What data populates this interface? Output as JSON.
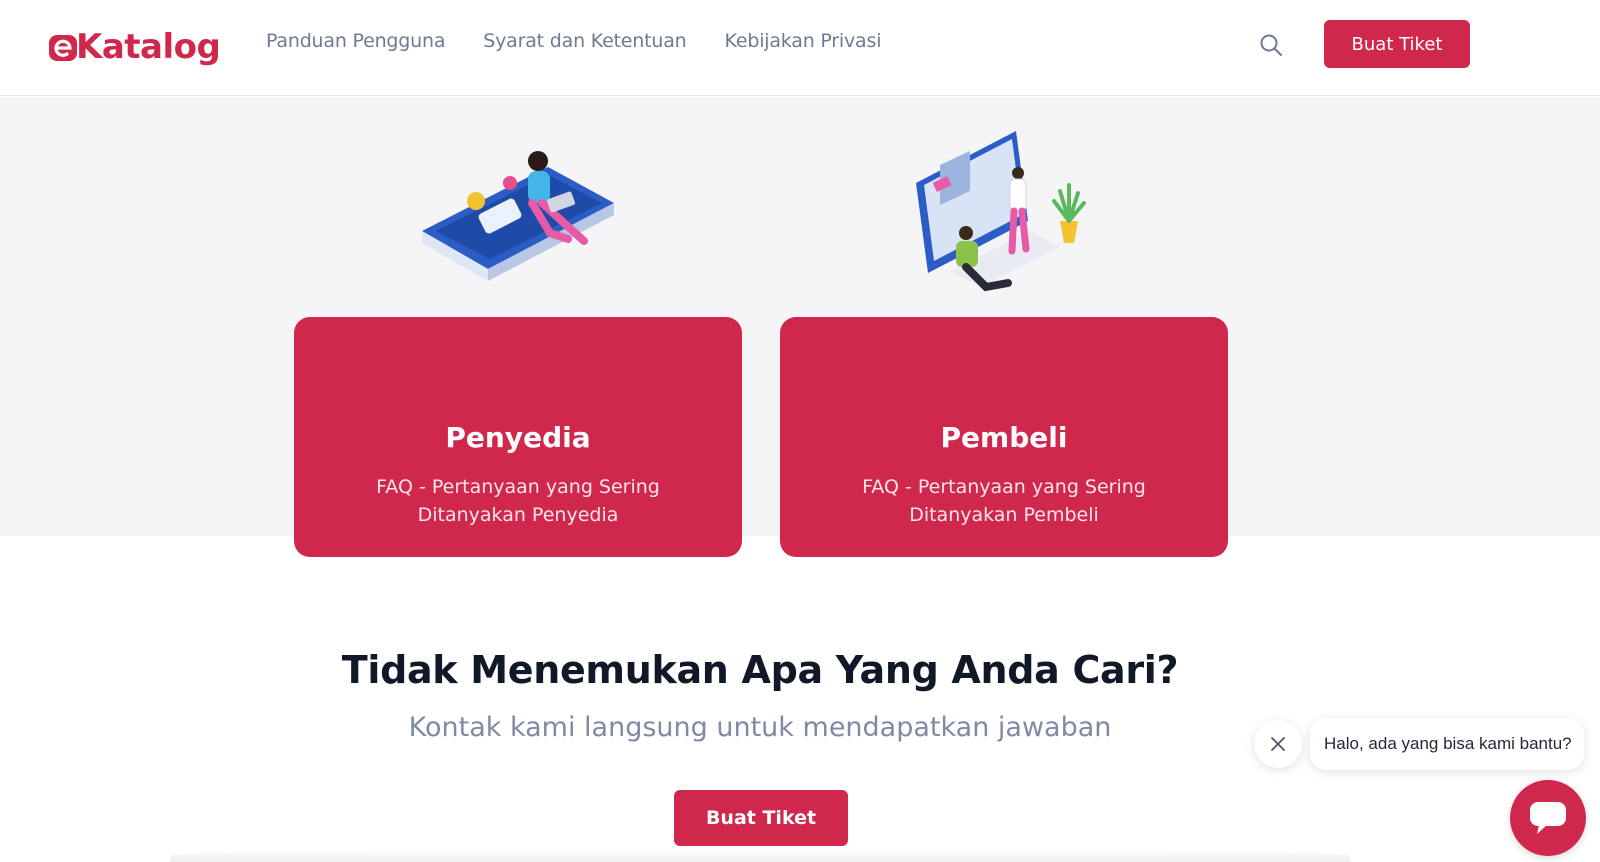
{
  "header": {
    "logo_text": "Katalog",
    "logo_prefix": "e",
    "nav": [
      "Panduan Pengguna",
      "Syarat dan Ketentuan",
      "Kebijakan Privasi"
    ],
    "search_icon": "search-icon",
    "cta_label": "Buat Tiket"
  },
  "cards": [
    {
      "title": "Penyedia",
      "description": "FAQ - Pertanyaan yang Sering Ditanyakan Penyedia",
      "illustration": "woman-on-phone-illustration"
    },
    {
      "title": "Pembeli",
      "description": "FAQ - Pertanyaan yang Sering Ditanyakan Pembeli",
      "illustration": "people-at-monitor-illustration"
    }
  ],
  "contact": {
    "title": "Tidak Menemukan Apa Yang Anda Cari?",
    "subtitle": "Kontak kami langsung untuk mendapatkan jawaban",
    "cta_label": "Buat Tiket"
  },
  "chat": {
    "message": "Halo, ada yang bisa kami bantu?",
    "close_icon": "close-icon",
    "launcher_icon": "chat-icon"
  },
  "colors": {
    "brand": "#d0284d",
    "nav_text": "#6f7b93",
    "hero_bg": "#f5f5f7",
    "heading": "#111827",
    "subheading": "#7f8aa3"
  }
}
